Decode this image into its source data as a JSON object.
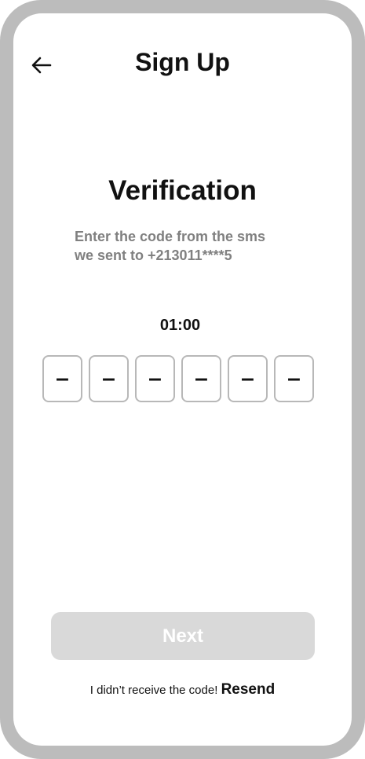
{
  "header": {
    "title": "Sign Up",
    "back_icon": "arrow-left-icon"
  },
  "main": {
    "heading": "Verification",
    "subtitle_line1": "Enter the code from the sms",
    "subtitle_line2": "we sent to +213011****5",
    "timer": "01:00",
    "code_digits": [
      "–",
      "–",
      "–",
      "–",
      "–",
      "–"
    ]
  },
  "footer": {
    "next_label": "Next",
    "resend_prompt": "I didn’t receive the code!",
    "resend_label": "Resend"
  },
  "colors": {
    "frame": "#bcbcbc",
    "text": "#111111",
    "subtitle": "#808080",
    "box_border": "#b8b8b8",
    "button_disabled": "#d9d9d9"
  }
}
